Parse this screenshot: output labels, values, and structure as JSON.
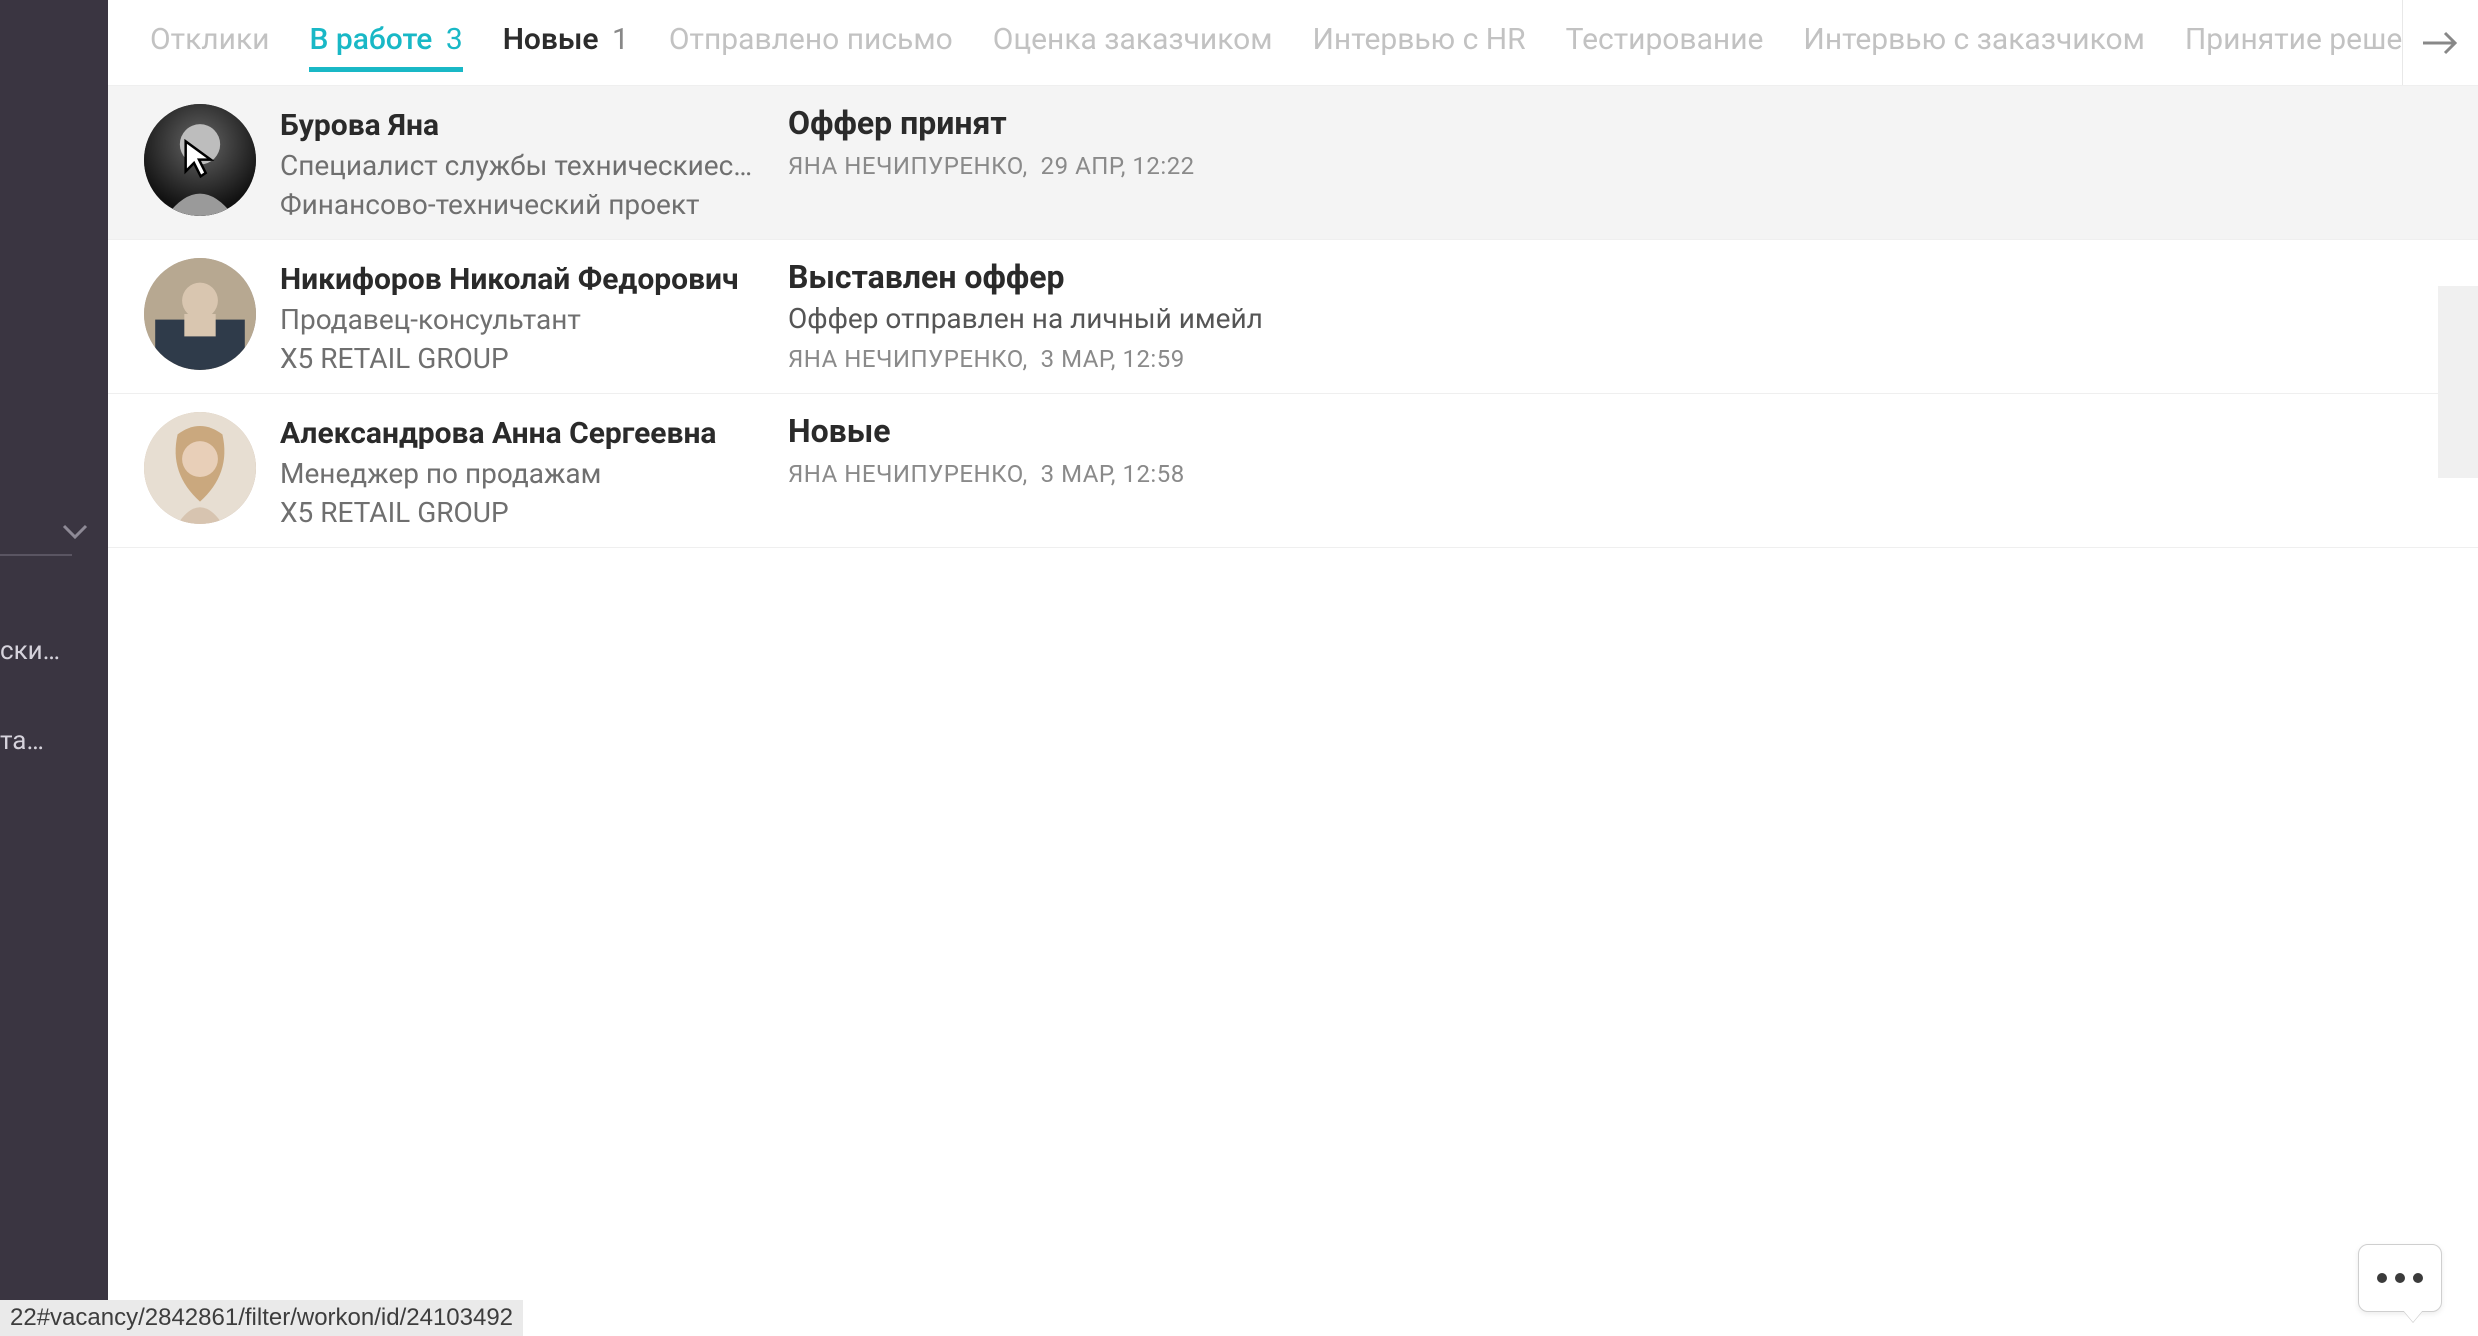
{
  "sidebar": {
    "item_a": "ски…",
    "item_b": "та…"
  },
  "tabs": [
    {
      "label": "Отклики",
      "count": ""
    },
    {
      "label": "В работе",
      "count": "3"
    },
    {
      "label": "Новые",
      "count": "1"
    },
    {
      "label": "Отправлено письмо",
      "count": ""
    },
    {
      "label": "Оценка заказчиком",
      "count": ""
    },
    {
      "label": "Интервью с HR",
      "count": ""
    },
    {
      "label": "Тестирование",
      "count": ""
    },
    {
      "label": "Интервью с заказчиком",
      "count": ""
    },
    {
      "label": "Принятие решения",
      "count": ""
    }
  ],
  "candidates": [
    {
      "name": "Бурова Яна",
      "role": "Специалист службы техническиеск…",
      "company": "Финансово-технический проект",
      "status_title": "Оффер принят",
      "status_note": "",
      "author": "ЯНА НЕЧИПУРЕНКО",
      "date": "29 АПР, 12:22"
    },
    {
      "name": "Никифоров Николай Федорович",
      "role": "Продавец-консультант",
      "company": "X5 RETAIL GROUP",
      "status_title": "Выставлен оффер",
      "status_note": "Оффер отправлен на личный имейл",
      "author": "ЯНА НЕЧИПУРЕНКО",
      "date": "3 МАР, 12:59"
    },
    {
      "name": "Александрова Анна Сергеевна",
      "role": "Менеджер по продажам",
      "company": "X5 RETAIL GROUP",
      "status_title": "Новые",
      "status_note": "",
      "author": "ЯНА НЕЧИПУРЕНКО",
      "date": "3 МАР, 12:58"
    }
  ],
  "url_hint": "22#vacancy/2842861/filter/workon/id/24103492"
}
